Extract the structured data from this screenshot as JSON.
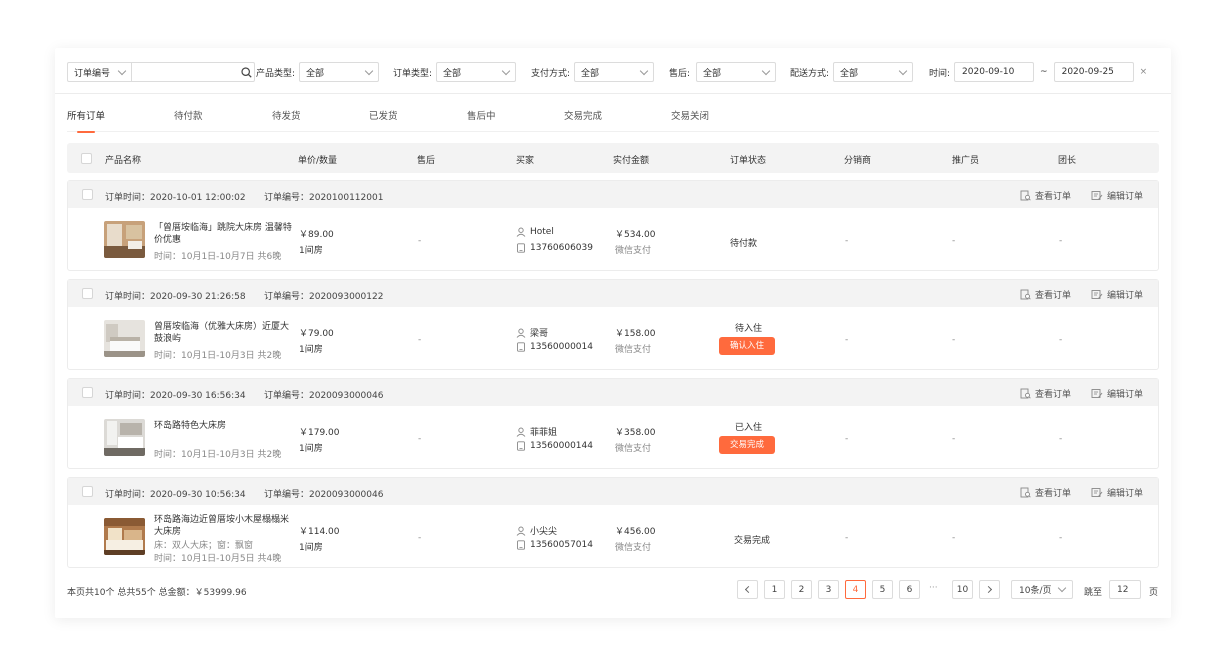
{
  "filters": {
    "search_type": "订单编号",
    "search_value": "",
    "product_type_label": "产品类型:",
    "product_type_value": "全部",
    "order_type_label": "订单类型:",
    "order_type_value": "全部",
    "payment_label": "支付方式:",
    "payment_value": "全部",
    "after_sale_label": "售后:",
    "after_sale_value": "全部",
    "delivery_label": "配送方式:",
    "delivery_value": "全部",
    "time_label": "时间:",
    "date_from": "2020-09-10",
    "date_sep": "~",
    "date_to": "2020-09-25",
    "clear": "×"
  },
  "tabs": [
    "所有订单",
    "待付款",
    "待发货",
    "已发货",
    "售后中",
    "交易完成",
    "交易关闭"
  ],
  "active_tab": 0,
  "columns": [
    "产品名称",
    "单价/数量",
    "售后",
    "买家",
    "实付金额",
    "订单状态",
    "分销商",
    "推广员",
    "团长"
  ],
  "order_actions": {
    "view": "查看订单",
    "edit": "编辑订单"
  },
  "orders": [
    {
      "time_text": "订单时间：2020-10-01  12:00:02",
      "no_text": "订单编号：2020100112001",
      "product_name": "「曾厝垵临海」跳院大床房 温馨特价优惠",
      "stay": "时间：10月1日-10月7日  共6晚",
      "price": "￥89.00",
      "qty": "1间房",
      "after_sale": "-",
      "buyer": "Hotel",
      "phone": "13760606039",
      "amount": "￥534.00",
      "pay_method": "微信支付",
      "status": "待付款",
      "status_button": "",
      "distributor": "-",
      "promoter": "-",
      "leader": "-"
    },
    {
      "time_text": "订单时间：2020-09-30  21:26:58",
      "no_text": "订单编号：2020093000122",
      "product_name": "曾厝垵临海（优雅大床房）近厦大鼓浪屿",
      "stay": "时间：10月1日-10月3日  共2晚",
      "price": "￥79.00",
      "qty": "1间房",
      "after_sale": "-",
      "buyer": "梁哥",
      "phone": "13560000014",
      "amount": "￥158.00",
      "pay_method": "微信支付",
      "status": "待入住",
      "status_button": "确认入住",
      "distributor": "-",
      "promoter": "-",
      "leader": "-"
    },
    {
      "time_text": "订单时间：2020-09-30  16:56:34",
      "no_text": "订单编号：2020093000046",
      "product_name": "环岛路特色大床房",
      "stay": "时间：10月1日-10月3日  共2晚",
      "price": "￥179.00",
      "qty": "1间房",
      "after_sale": "-",
      "buyer": "菲菲姐",
      "phone": "13560000144",
      "amount": "￥358.00",
      "pay_method": "微信支付",
      "status": "已入住",
      "status_button": "交易完成",
      "distributor": "-",
      "promoter": "-",
      "leader": "-"
    },
    {
      "time_text": "订单时间：2020-09-30  10:56:34",
      "no_text": "订单编号：2020093000046",
      "product_name": "环岛路海边近曾厝垵小木屋榻榻米大床房",
      "product_extra": "床：双人大床；窗：飘窗",
      "stay": "时间：10月1日-10月5日  共4晚",
      "price": "￥114.00",
      "qty": "1间房",
      "after_sale": "-",
      "buyer": "小尖尖",
      "phone": "13560057014",
      "amount": "￥456.00",
      "pay_method": "微信支付",
      "status": "交易完成",
      "status_button": "",
      "distributor": "-",
      "promoter": "-",
      "leader": "-"
    }
  ],
  "footer": {
    "summary": "本页共10个  总共55个  总金额：￥53999.96",
    "pages": [
      "1",
      "2",
      "3",
      "4",
      "5",
      "6"
    ],
    "current_page": "4",
    "ellipsis": "···",
    "last_page": "10",
    "page_size": "10条/页",
    "jump_label": "跳至",
    "jump_value": "12",
    "page_unit": "页"
  },
  "colors": {
    "accent": "#ff6a3d",
    "header_bg": "#f3f3f3",
    "border": "#ececec"
  },
  "icons": [
    "search-icon",
    "chevron-down-icon",
    "view-order-icon",
    "edit-order-icon",
    "user-icon",
    "phone-icon",
    "chevron-left-icon",
    "chevron-right-icon"
  ]
}
